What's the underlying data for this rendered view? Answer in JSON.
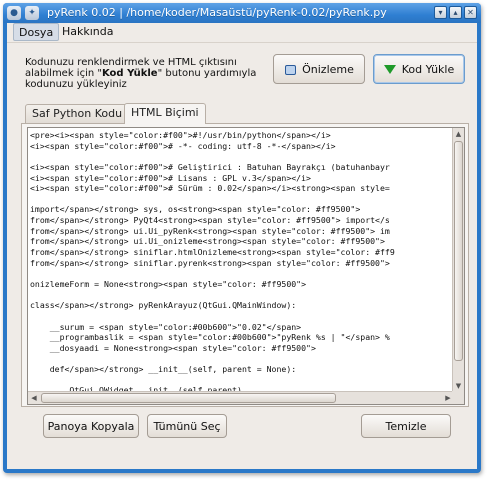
{
  "window": {
    "title": "pyRenk 0.02 | /home/koder/Masaüstü/pyRenk-0.02/pyRenk.py",
    "app_icon": "app-icon",
    "pin_icon": "pin-icon",
    "controls": [
      "minimize-icon",
      "maximize-icon",
      "close-icon"
    ]
  },
  "menu": {
    "items": [
      "Dosya",
      "Hakkında"
    ]
  },
  "intro": {
    "line1": "Kodunuzu renklendirmek ve HTML çıktısını",
    "line2_prefix": "alabilmek için \"",
    "line2_bold": "Kod Yükle",
    "line2_suffix": "\" butonu yardımıyla",
    "line3": "kodunuzu yükleyiniz"
  },
  "buttons": {
    "preview": "Önizleme",
    "load": "Kod Yükle",
    "copy": "Panoya Kopyala",
    "select_all": "Tümünü Seç",
    "clear": "Temizle"
  },
  "tabs": [
    "Saf Python Kodu",
    "HTML Biçimi"
  ],
  "code_lines": [
    "<pre><i><span style=\"color:#f00\">#!/usr/bin/python</span></i>",
    "<i><span style=\"color:#f00\"># -*- coding: utf-8 -*-</span></i>",
    "",
    "<i><span style=\"color:#f00\"># Geliştirici : Batuhan Bayrakçı (batuhanbayr",
    "<i><span style=\"color:#f00\"># Lisans : GPL v.3</span></i>",
    "<i><span style=\"color:#f00\"># Sürüm : 0.02</span></i><strong><span style=",
    "",
    "import</span></strong> sys, os<strong><span style=\"color: #ff9500\">",
    "from</span></strong> PyQt4<strong><span style=\"color: #ff9500\"> import</s",
    "from</span></strong> ui.Ui_pyRenk<strong><span style=\"color: #ff9500\"> im",
    "from</span></strong> ui.Ui_onizleme<strong><span style=\"color: #ff9500\">",
    "from</span></strong> siniflar.htmlOnizleme<strong><span style=\"color: #ff9",
    "from</span></strong> siniflar.pyrenk<strong><span style=\"color: #ff9500\">",
    "",
    "onizlemeForm = None<strong><span style=\"color: #ff9500\">",
    "",
    "class</span></strong> pyRenkArayuz(QtGui.QMainWindow):",
    "",
    "    __surum = <span style=\"color:#00b600\">\"0.02\"</span>",
    "    __programbaslik = <span style=\"color:#00b600\">\"pyRenk %s | \"</span> %",
    "    __dosyaadi = None<strong><span style=\"color: #ff9500\">",
    "",
    "    def</span></strong> __init__(self, parent = None):",
    "",
    "        QtGui.QWidget.__init__(self,parent)"
  ]
}
